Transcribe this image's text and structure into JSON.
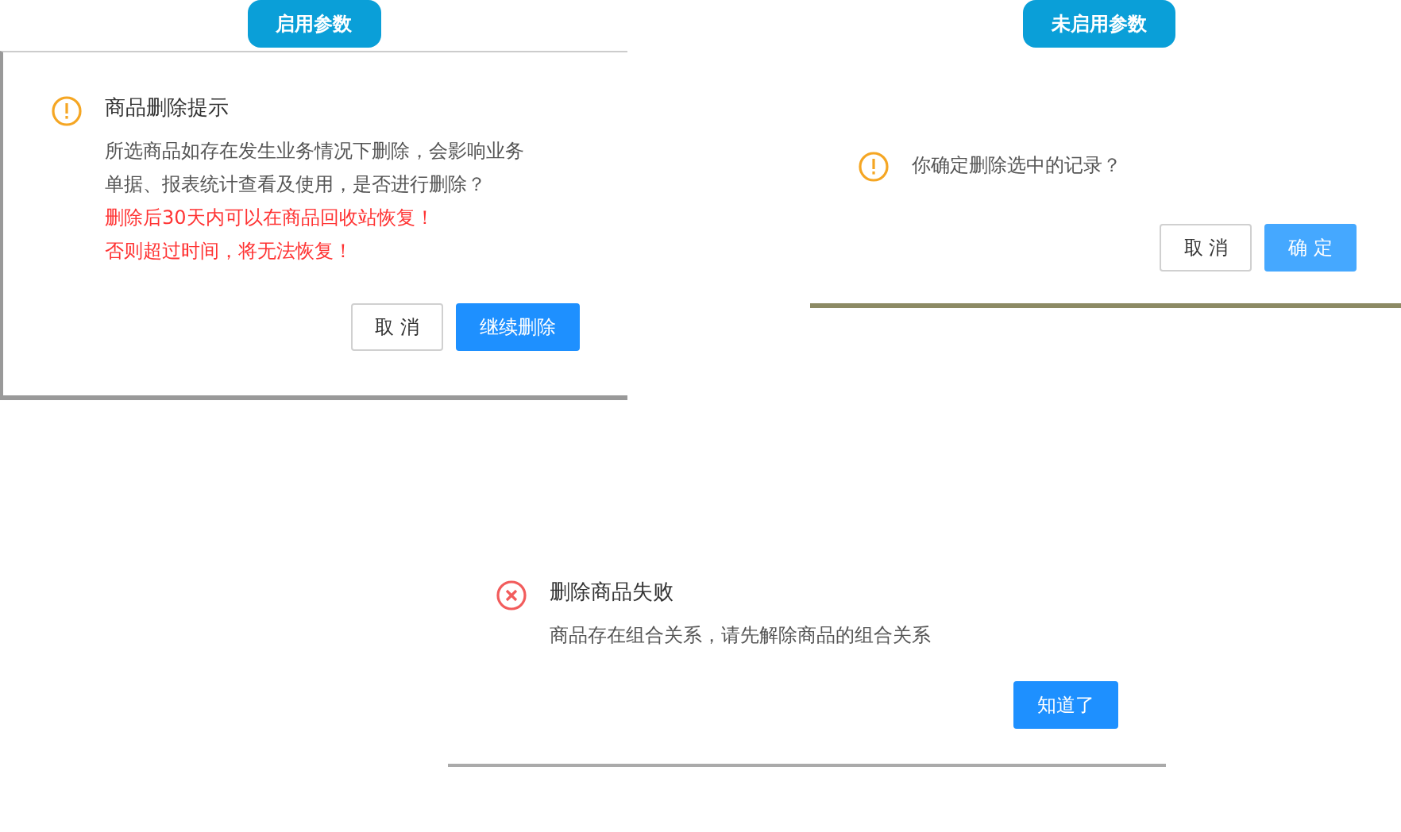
{
  "top_dialogs": [
    {
      "header": "启用参数",
      "kind": "warning",
      "title": "商品删除提示",
      "messages": [
        {
          "text": "所选商品如存在发生业务情况下删除，会影响业务单据、报表统计查看及使用，是否进行删除？",
          "kind": "normal"
        },
        {
          "text": "删除后30天内可以在商品回收站恢复！",
          "kind": "danger"
        },
        {
          "text": "否则超过时间，将无法恢复！",
          "kind": "danger"
        }
      ],
      "buttons": [
        {
          "label": "取 消",
          "kind": "default"
        },
        {
          "label": "继续删除",
          "kind": "primary"
        }
      ]
    },
    {
      "header": "未启用参数",
      "kind": "warning",
      "messages": [
        {
          "text": "你确定删除选中的记录？",
          "kind": "normal"
        }
      ],
      "buttons": [
        {
          "label": "取 消",
          "kind": "default"
        },
        {
          "label": "确 定",
          "kind": "primary-light"
        }
      ]
    }
  ],
  "bottom_dialog": {
    "kind": "error",
    "title": "删除商品失败",
    "messages": [
      {
        "text": "商品存在组合关系，请先解除商品的组合关系",
        "kind": "normal"
      }
    ],
    "buttons": [
      {
        "label": "知道了",
        "kind": "primary"
      }
    ]
  }
}
